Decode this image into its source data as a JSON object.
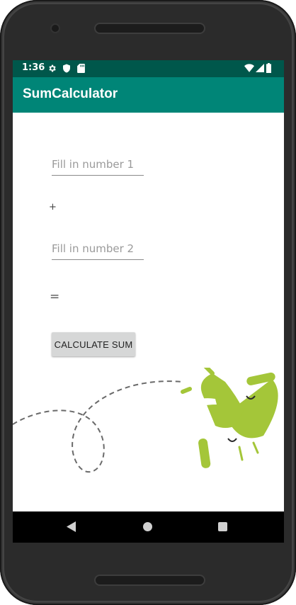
{
  "status_bar": {
    "time": "1:36",
    "left_icons": [
      "gear-icon",
      "shield-icon",
      "sd-card-icon"
    ],
    "right_icons": [
      "wifi-icon",
      "signal-icon",
      "battery-icon"
    ]
  },
  "app_bar": {
    "title": "SumCalculator",
    "color": "#008577",
    "status_color": "#00574b"
  },
  "form": {
    "number1": {
      "placeholder": "Fill in number 1",
      "value": ""
    },
    "plus_sign": "+",
    "number2": {
      "placeholder": "Fill in number 2",
      "value": ""
    },
    "equals_sign": "=",
    "result": "",
    "calculate_button": "CALCULATE SUM"
  },
  "illustration": {
    "name": "android-mascot",
    "color": "#a4c639"
  },
  "nav_bar": {
    "buttons": [
      "back-icon",
      "home-icon",
      "recents-icon"
    ]
  }
}
